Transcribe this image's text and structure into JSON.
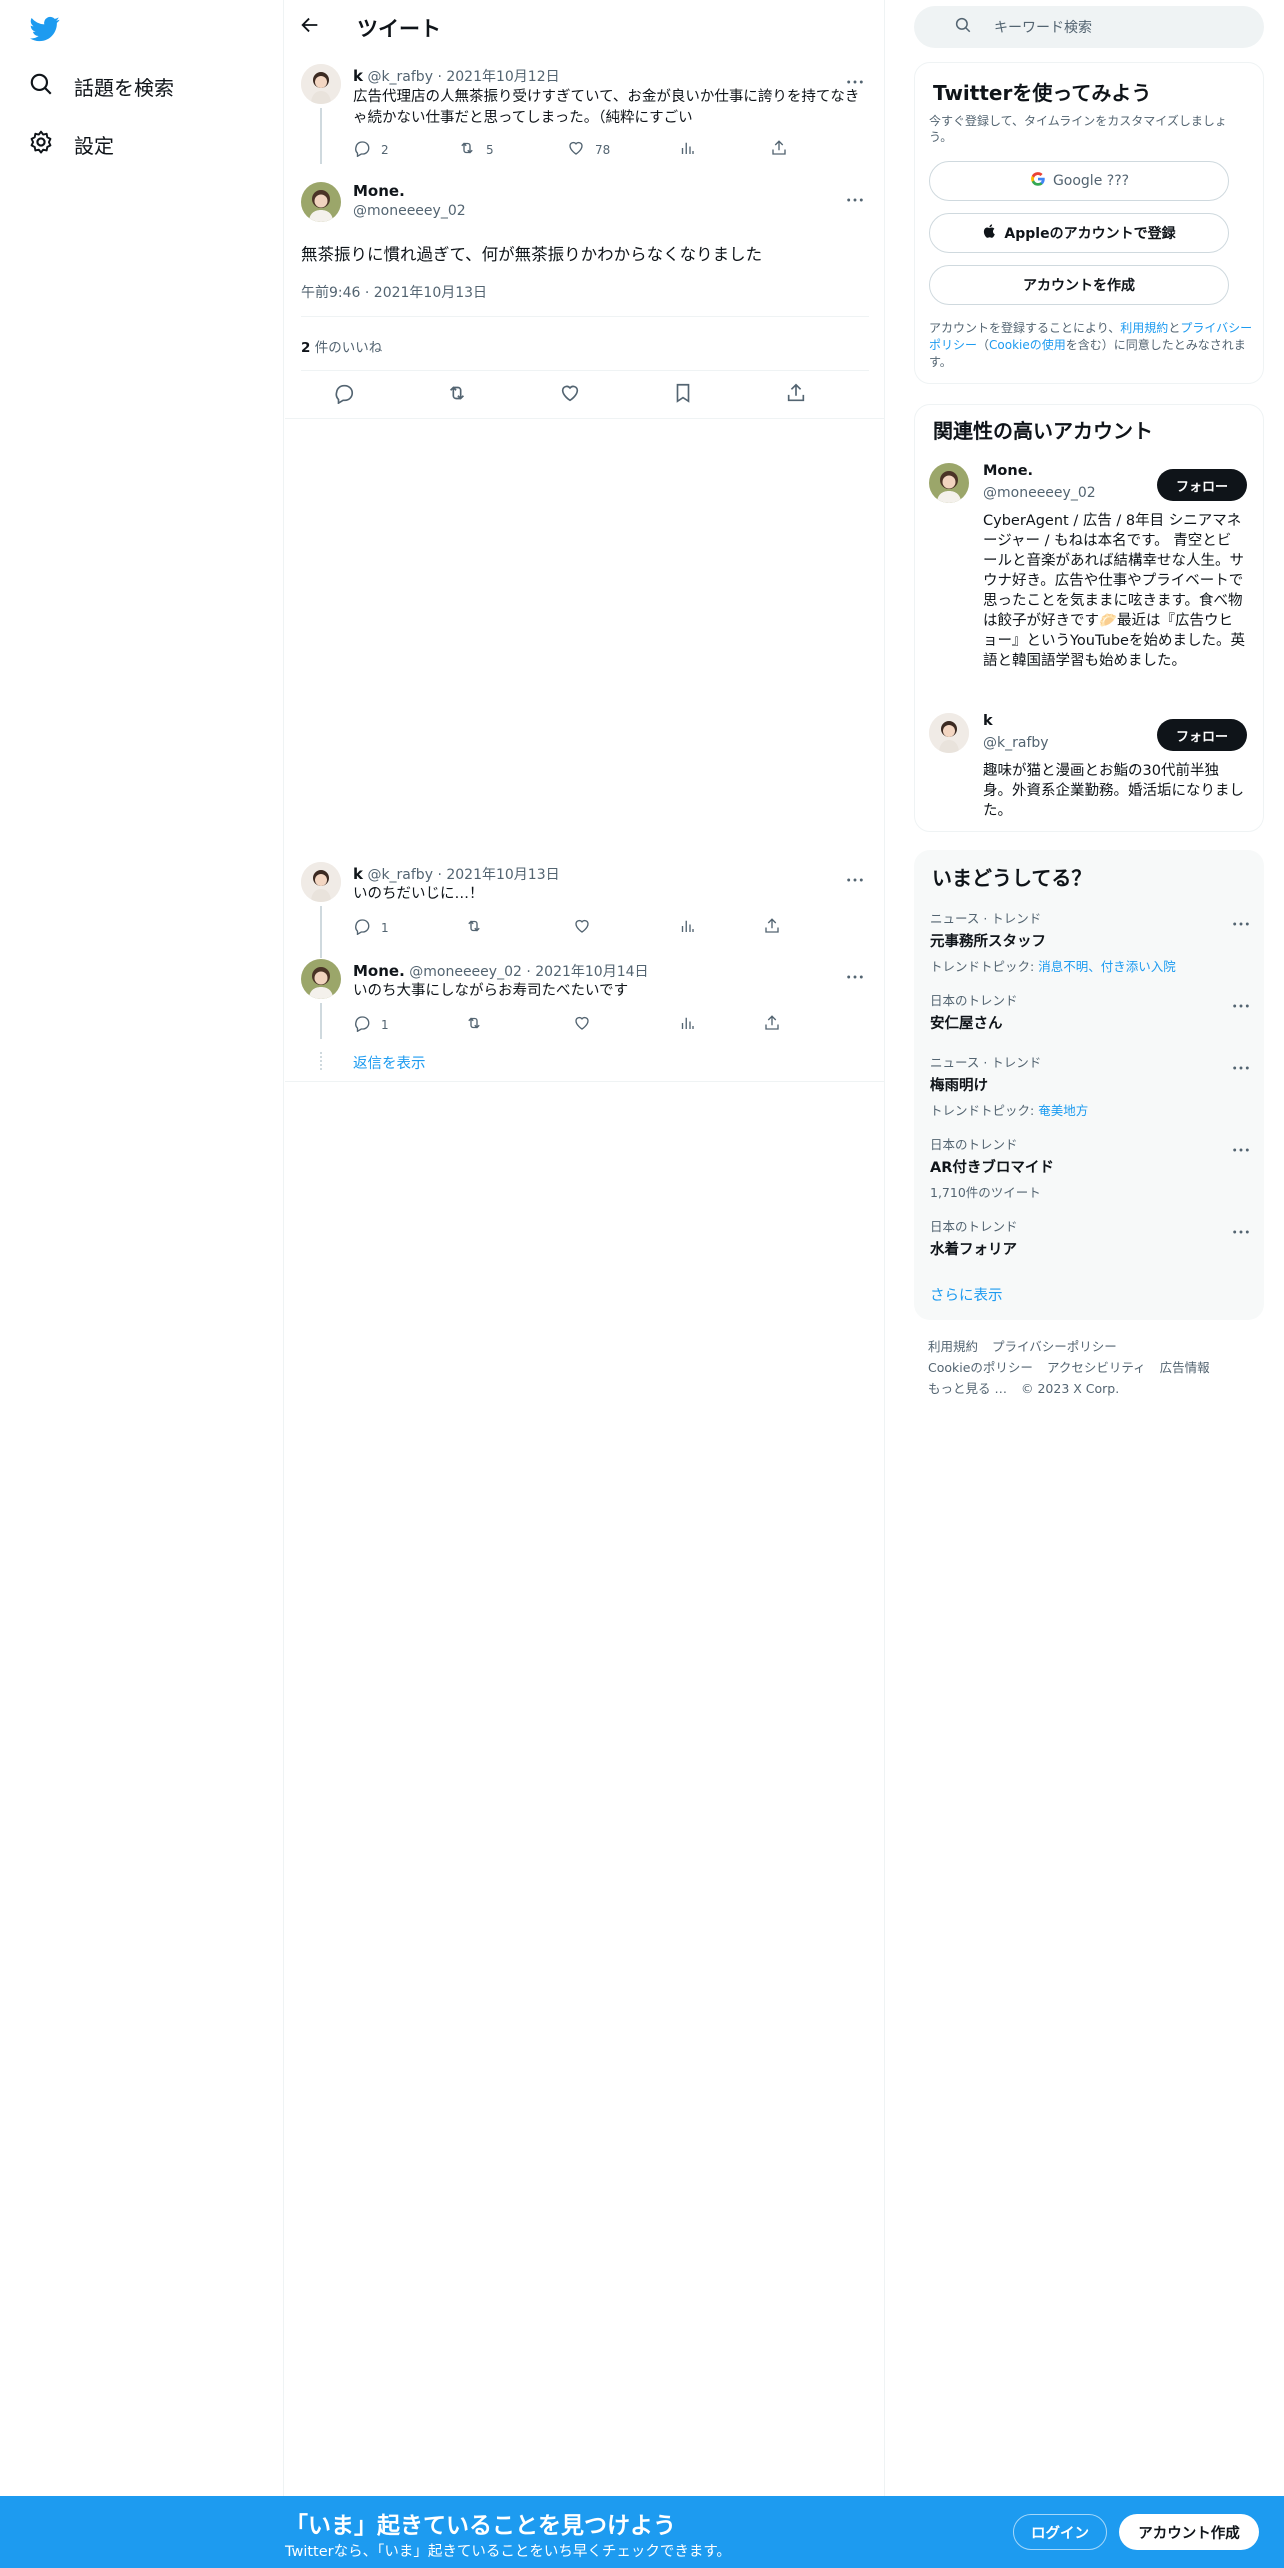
{
  "colors": {
    "brand": "#1d9bf0",
    "text": "#0f1419",
    "muted": "#536471"
  },
  "nav": {
    "logo": "twitter-bird-icon",
    "items": [
      {
        "label": "話題を検索",
        "icon": "search-icon"
      },
      {
        "label": "設定",
        "icon": "gear-icon"
      }
    ]
  },
  "header": {
    "title": "ツイート"
  },
  "thread": {
    "parent": {
      "name": "k",
      "handle": "@k_rafby",
      "date": "2021年10月12日",
      "text": "広告代理店の人無茶振り受けすぎていて、お金が良いか仕事に誇りを持てなきゃ続かない仕事だと思ってしまった。（純粋にすごい",
      "replies": "2",
      "retweets": "5",
      "likes": "78"
    },
    "main": {
      "name": "Mone.",
      "handle": "@moneeeey_02",
      "text": "無茶振りに慣れ過ぎて、何が無茶振りかわからなくなりました",
      "time": "午前9:46 · 2021年10月13日",
      "likes_count": "2",
      "likes_label": "件のいいね"
    },
    "replies": [
      {
        "name": "k",
        "handle": "@k_rafby",
        "date": "2021年10月13日",
        "text": "いのちだいじに…！",
        "replies": "1"
      },
      {
        "name": "Mone.",
        "handle": "@moneeeey_02",
        "date": "2021年10月14日",
        "text": "いのち大事にしながらお寿司たべたいです",
        "replies": "1"
      }
    ],
    "show_replies": "返信を表示"
  },
  "search": {
    "placeholder": "キーワード検索"
  },
  "signup_card": {
    "title": "Twitterを使ってみよう",
    "subtitle": "今すぐ登録して、タイムラインをカスタマイズしましょう。",
    "google": "Google ???",
    "apple": "Appleのアカウントで登録",
    "create": "アカウントを作成",
    "terms_pre": "アカウントを登録することにより、",
    "terms_link1": "利用規約",
    "terms_mid": "と",
    "terms_link2": "プライバシーポリシー",
    "terms_mid2": "（",
    "terms_link3": "Cookieの使用",
    "terms_post": "を含む）に同意したとみなされます。"
  },
  "related": {
    "title": "関連性の高いアカウント",
    "follow": "フォロー",
    "accounts": [
      {
        "name": "Mone.",
        "handle": "@moneeeey_02",
        "bio": "CyberAgent / 広告 / 8年目 シニアマネージャー / もねは本名です。 青空とビールと音楽があれば結構幸せな人生。サウナ好き。広告や仕事やプライベートで思ったことを気ままに呟きます。食べ物は餃子が好きです🥟最近は『広告ウヒョー』というYouTubeを始めました。英語と韓国語学習も始めました。"
      },
      {
        "name": "k",
        "handle": "@k_rafby",
        "bio": "趣味が猫と漫画とお鮨の30代前半独身。外資系企業勤務。婚活垢になりました。"
      }
    ]
  },
  "trends": {
    "title": "いまどうしてる？",
    "items": [
      {
        "category": "ニュース · トレンド",
        "name": "元事務所スタッフ",
        "sub_pre": "トレンドトピック: ",
        "sub_link": "消息不明、付き添い入院"
      },
      {
        "category": "日本のトレンド",
        "name": "安仁屋さん",
        "sub_pre": "",
        "sub_link": ""
      },
      {
        "category": "ニュース · トレンド",
        "name": "梅雨明け",
        "sub_pre": "トレンドトピック: ",
        "sub_link": "奄美地方"
      },
      {
        "category": "日本のトレンド",
        "name": "AR付きブロマイド",
        "sub_pre": "1,710件のツイート",
        "sub_link": ""
      },
      {
        "category": "日本のトレンド",
        "name": "水着フォリア",
        "sub_pre": "",
        "sub_link": ""
      }
    ],
    "more": "さらに表示"
  },
  "footer": {
    "links": [
      "利用規約",
      "プライバシーポリシー",
      "Cookieのポリシー",
      "アクセシビリティ",
      "広告情報",
      "もっと見る …"
    ],
    "copyright": "© 2023 X Corp."
  },
  "bottombar": {
    "title": "「いま」起きていることを見つけよう",
    "subtitle": "Twitterなら、「いま」起きていることをいち早くチェックできます。",
    "login": "ログイン",
    "signup": "アカウント作成"
  }
}
